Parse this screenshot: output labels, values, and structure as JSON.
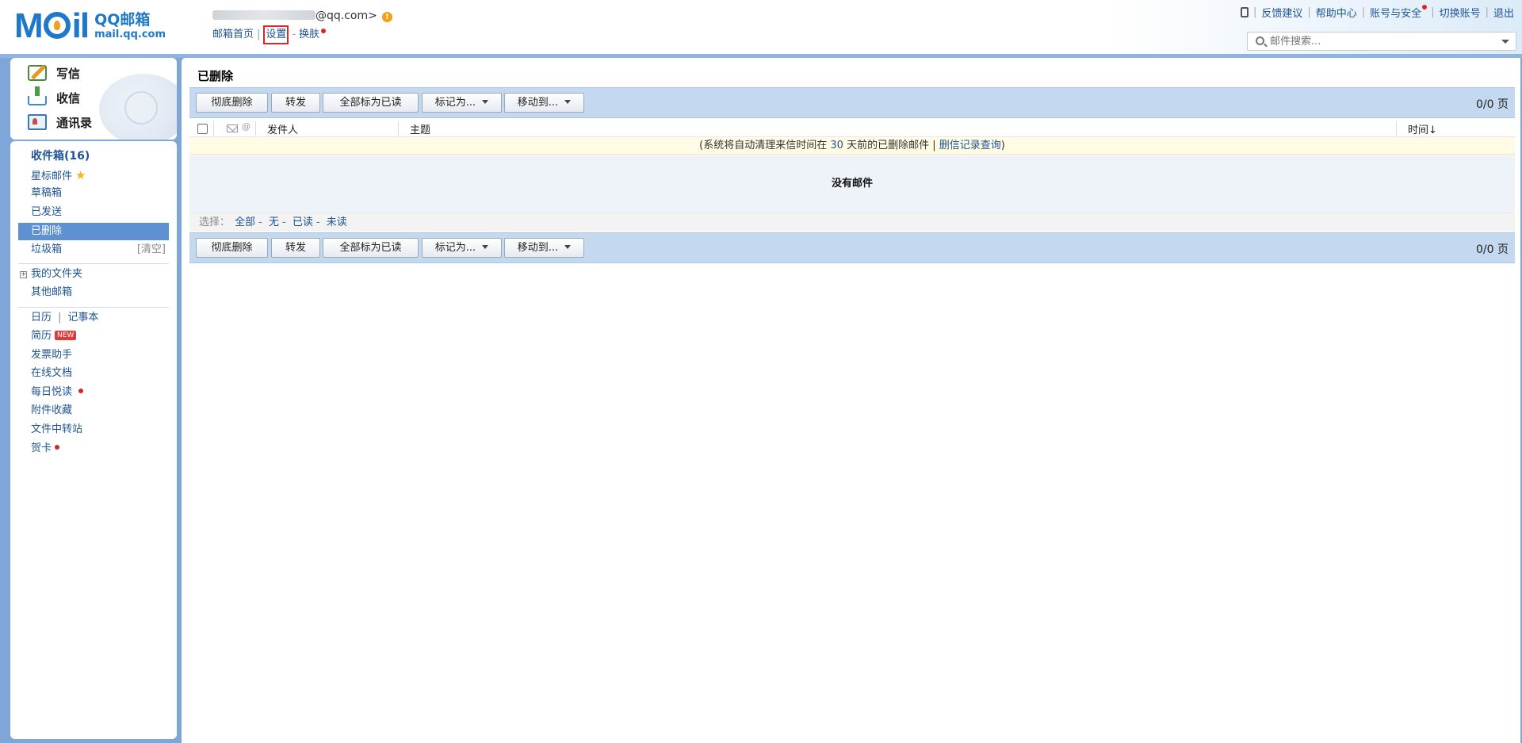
{
  "logo": {
    "mark": "M",
    "mark_tail": "il",
    "name_cn": "QQ邮箱",
    "name_en": "mail.qq.com"
  },
  "account": {
    "address": "@qq.com>",
    "warning_icon": "warning-icon"
  },
  "topnav": {
    "home": "邮箱首页",
    "settings": "设置",
    "skin": "换肤",
    "sep1": "|",
    "sep2": "-"
  },
  "toplinks": {
    "sep": "|",
    "feedback": "反馈建议",
    "help": "帮助中心",
    "security": "账号与安全",
    "switch": "切换账号",
    "logout": "退出"
  },
  "search": {
    "placeholder": "邮件搜索..."
  },
  "quick": {
    "write": "写信",
    "receive": "收信",
    "contacts": "通讯录"
  },
  "sidebar": {
    "inbox": "收件箱(16)",
    "starred": "星标邮件",
    "drafts": "草稿箱",
    "sent": "已发送",
    "deleted": "已删除",
    "trash": "垃圾箱",
    "trash_clear": "[清空]",
    "my_folders": "我的文件夹",
    "plus": "+",
    "other_mailbox": "其他邮箱",
    "calendar": "日历",
    "sep": "|",
    "notebook": "记事本",
    "resume": "简历",
    "new_badge": "NEW",
    "invoice": "发票助手",
    "docs": "在线文档",
    "daily_reading": "每日悦读",
    "attachments": "附件收藏",
    "file_transfer": "文件中转站",
    "cards": "贺卡"
  },
  "main": {
    "title": "已删除",
    "buttons": {
      "delete_forever": "彻底删除",
      "forward": "转发",
      "mark_all_read": "全部标为已读",
      "mark_as": "标记为...",
      "move_to": "移动到..."
    },
    "pager": "0/0 页",
    "columns": {
      "sender": "发件人",
      "subject": "主题",
      "time": "时间↓",
      "attach": "@"
    },
    "notice": {
      "prefix": "(系统将自动清理来信时间在 ",
      "days": "30",
      "middle": " 天前的已删除邮件 | ",
      "link": "删信记录查询",
      "suffix": ")"
    },
    "empty": "没有邮件",
    "select": {
      "label": "选择：",
      "all": "全部",
      "none": "无",
      "read": "已读",
      "unread": "未读",
      "dash": "-"
    }
  }
}
